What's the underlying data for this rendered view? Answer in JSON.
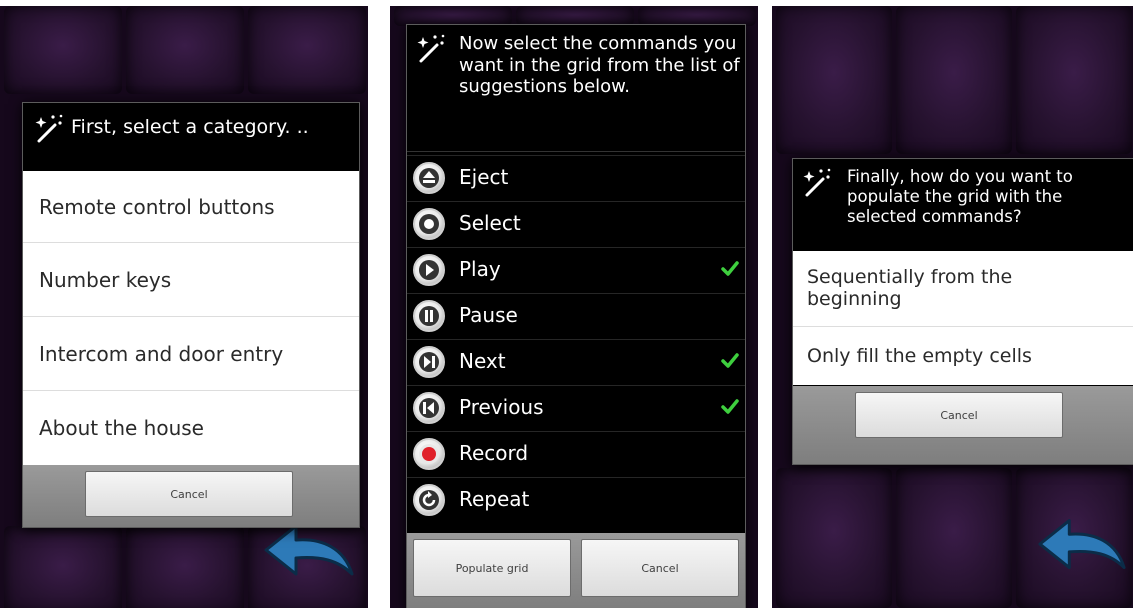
{
  "screen1": {
    "title": "First, select a category. ..",
    "options": [
      "Remote control buttons",
      "Number keys",
      "Intercom and door entry",
      "About the house"
    ],
    "cancel_label": "Cancel"
  },
  "screen2": {
    "title": "Now select the commands you want in the grid from the list of suggestions below.",
    "commands": [
      {
        "label": "Eject",
        "icon": "eject-icon",
        "checked": false
      },
      {
        "label": "Select",
        "icon": "circle-icon",
        "checked": false
      },
      {
        "label": "Play",
        "icon": "play-icon",
        "checked": true
      },
      {
        "label": "Pause",
        "icon": "pause-icon",
        "checked": false
      },
      {
        "label": "Next",
        "icon": "next-icon",
        "checked": true
      },
      {
        "label": "Previous",
        "icon": "previous-icon",
        "checked": true
      },
      {
        "label": "Record",
        "icon": "record-icon",
        "checked": false
      },
      {
        "label": "Repeat",
        "icon": "repeat-icon",
        "checked": false
      }
    ],
    "populate_label": "Populate grid",
    "cancel_label": "Cancel"
  },
  "screen3": {
    "title": "Finally, how do you want to populate the grid with the selected commands?",
    "options": [
      "Sequentially from the beginning",
      "Only fill the empty cells"
    ],
    "cancel_label": "Cancel"
  },
  "colors": {
    "background_cell": "#2a1333",
    "dialog": "#000000",
    "check": "#3ecf3e",
    "back_arrow": "#2d7ab8",
    "record_dot": "#e0202a"
  }
}
